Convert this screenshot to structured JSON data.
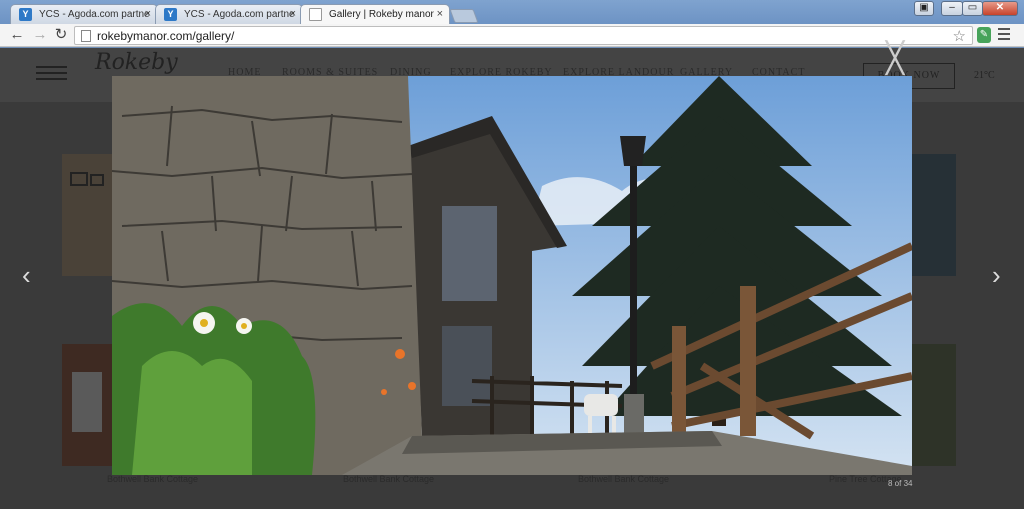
{
  "browser": {
    "tabs": [
      {
        "title": "YCS - Agoda.com partne",
        "favicon": "Y"
      },
      {
        "title": "YCS - Agoda.com partne",
        "favicon": "Y"
      },
      {
        "title": "Gallery | Rokeby manor",
        "favicon": ""
      }
    ],
    "tab_close_glyph": "×",
    "url": "rokebymanor.com/gallery/",
    "nav": {
      "back": "←",
      "forward": "→",
      "reload": "↻"
    },
    "bookmark_star": "☆",
    "window_controls": {
      "minimize": "–",
      "restore": "▭",
      "close": "✕"
    }
  },
  "site": {
    "logo_text": "Rokeby",
    "nav_items": [
      "HOME",
      "ROOMS & SUITES",
      "DINING",
      "EXPLORE ROKEBY",
      "EXPLORE LANDOUR",
      "GALLERY",
      "CONTACT"
    ],
    "book_now": "BOOK NOW",
    "temperature": "21°C"
  },
  "gallery": {
    "captions": [
      "Bothwell Bank Cottage",
      "Bothwell Bank Cottage",
      "Bothwell Bank Cottage",
      "Pine Tree Cottage"
    ]
  },
  "lightbox": {
    "close_glyph": "╳",
    "prev_glyph": "‹",
    "next_glyph": "›",
    "counter": "8 of 34"
  },
  "icons": {
    "tab_page": "page-icon",
    "bookmark": "star-icon",
    "extension": "evernote-icon",
    "menu": "hamburger-menu-icon"
  }
}
